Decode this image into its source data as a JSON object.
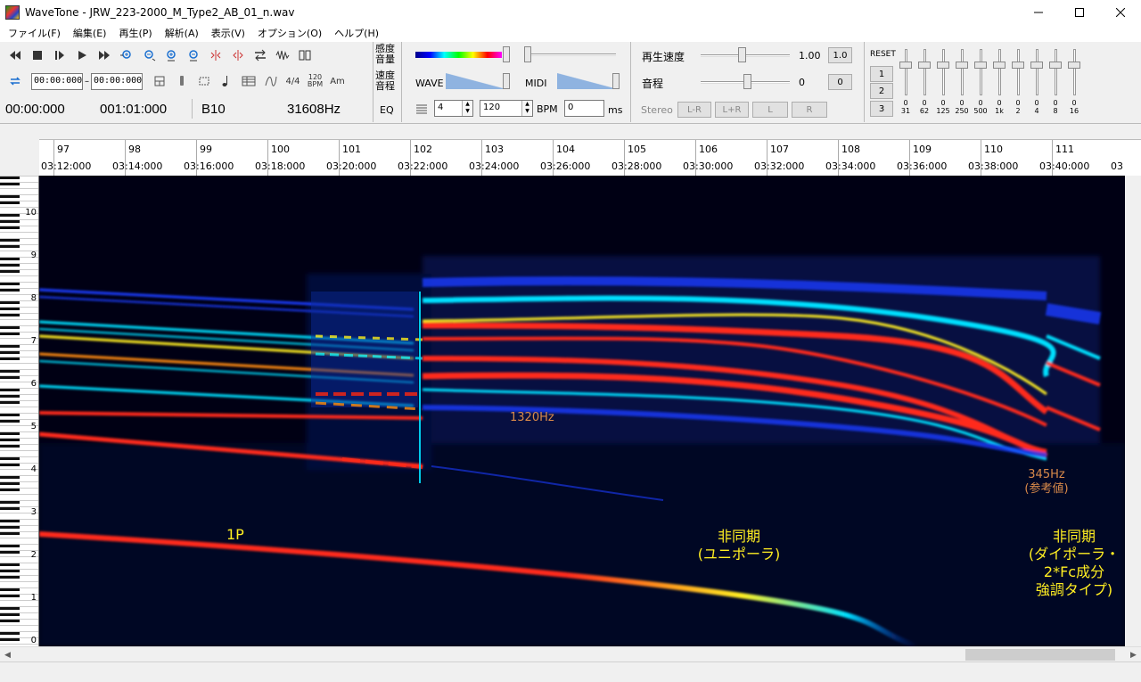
{
  "window": {
    "title": "WaveTone - JRW_223-2000_M_Type2_AB_01_n.wav",
    "minimize": "—",
    "maximize": "☐",
    "close": "✕"
  },
  "menu": [
    "ファイル(F)",
    "編集(E)",
    "再生(P)",
    "解析(A)",
    "表示(V)",
    "オプション(O)",
    "ヘルプ(H)"
  ],
  "toolbar": {
    "time_from": "00:00:000",
    "time_to": "00:00:000",
    "time_sep": "–",
    "meter": "4/4",
    "bpm_icon_top": "120",
    "bpm_icon_bottom": "BPM",
    "chord_icon": "Am",
    "status_time": "00:00:000",
    "status_bar": "001:01:000",
    "status_note": "B10",
    "status_freq": "31608Hz",
    "eq_label": "EQ",
    "sensitivity_label_1": "感度",
    "sensitivity_label_2": "音量",
    "speed_label_1": "速度",
    "speed_label_2": "音程",
    "wave_label": "WAVE",
    "midi_label": "MIDI",
    "beat_value": "4",
    "bpm_value": "120",
    "bpm_label": "BPM",
    "delay_value": "0",
    "ms_label": "ms",
    "playback_speed_label": "再生速度",
    "playback_speed_value": "1.00",
    "playback_speed_reset": "1.0",
    "pitch_label": "音程",
    "pitch_value": "0",
    "pitch_reset": "0",
    "stereo_label": "Stereo",
    "ch_lr_minus": "L-R",
    "ch_lr_plus": "L+R",
    "ch_l": "L",
    "ch_r": "R",
    "reset_label": "RESET",
    "preset_1": "1",
    "preset_2": "2",
    "preset_3": "3"
  },
  "eq_bands": [
    {
      "value": "0",
      "freq": "31"
    },
    {
      "value": "0",
      "freq": "62"
    },
    {
      "value": "0",
      "freq": "125"
    },
    {
      "value": "0",
      "freq": "250"
    },
    {
      "value": "0",
      "freq": "500"
    },
    {
      "value": "0",
      "freq": "1k"
    },
    {
      "value": "0",
      "freq": "2"
    },
    {
      "value": "0",
      "freq": "4"
    },
    {
      "value": "0",
      "freq": "8"
    },
    {
      "value": "0",
      "freq": "16"
    }
  ],
  "ruler": {
    "bars": [
      "97",
      "98",
      "99",
      "100",
      "101",
      "102",
      "103",
      "104",
      "105",
      "106",
      "107",
      "108",
      "109",
      "110",
      "111"
    ],
    "times": [
      "03:12:000",
      "03:14:000",
      "03:16:000",
      "03:18:000",
      "03:20:000",
      "03:22:000",
      "03:24:000",
      "03:26:000",
      "03:28:000",
      "03:30:000",
      "03:32:000",
      "03:34:000",
      "03:36:000",
      "03:38:000",
      "03:40:000",
      "03"
    ]
  },
  "keyboard_octaves": [
    "10",
    "9",
    "8",
    "7",
    "6",
    "5",
    "4",
    "3",
    "2",
    "1",
    "0"
  ],
  "annotations": {
    "a_1320": "1320Hz",
    "a_345_1": "345Hz",
    "a_345_2": "(参考値)",
    "a_1p": "1P",
    "a_async1_1": "非同期",
    "a_async1_2": "(ユニポーラ)",
    "a_async2_1": "非同期",
    "a_async2_2": "(ダイポーラ・",
    "a_async2_3": "2*Fc成分",
    "a_async2_4": "強調タイプ)"
  },
  "colors": {
    "spectrogram_bg": "#000014",
    "hot": "#ff2a1a",
    "warm": "#ffee22",
    "mid": "#00e0ff",
    "cool": "#1a3cff",
    "annotation_yellow": "#ffee22",
    "annotation_orange": "#d98a4a"
  }
}
